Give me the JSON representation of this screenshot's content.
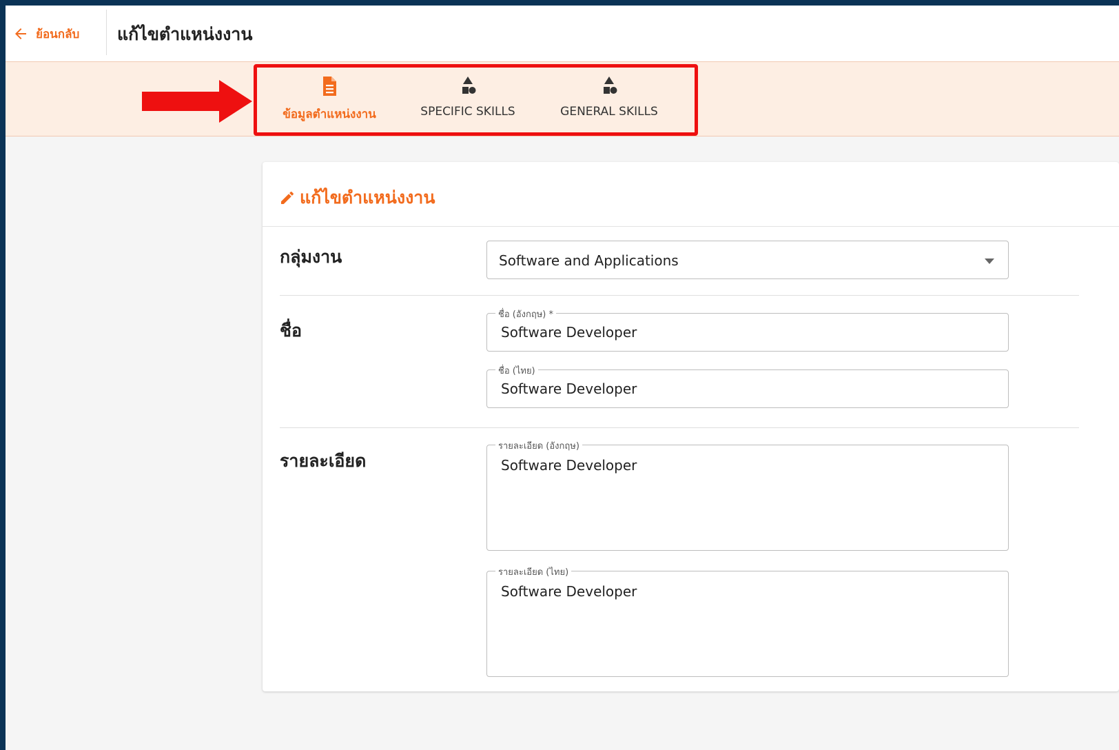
{
  "header": {
    "back_label": "ย้อนกลับ",
    "title": "แก้ไขตำแหน่งงาน"
  },
  "tabs": [
    {
      "label": "ข้อมูลตำแหน่งงาน",
      "icon": "file-document-icon",
      "active": true
    },
    {
      "label": "SPECIFIC SKILLS",
      "icon": "shapes-icon",
      "active": false
    },
    {
      "label": "GENERAL SKILLS",
      "icon": "shapes-icon",
      "active": false
    }
  ],
  "annotation": {
    "box_color": "#ee1010",
    "arrow_color": "#ee1010"
  },
  "card": {
    "title": "แก้ไขตำแหน่งงาน",
    "rows": {
      "job_group": {
        "label": "กลุ่มงาน",
        "value": "Software and Applications"
      },
      "name": {
        "label": "ชื่อ",
        "name_en_label": "ชื่อ (อังกฤษ) *",
        "name_en_value": "Software Developer",
        "name_th_label": "ชื่อ (ไทย)",
        "name_th_value": "Software Developer"
      },
      "detail": {
        "label": "รายละเอียด",
        "detail_en_label": "รายละเอียด (อังกฤษ)",
        "detail_en_value": "Software Developer",
        "detail_th_label": "รายละเอียด (ไทย)",
        "detail_th_value": "Software Developer"
      }
    }
  },
  "colors": {
    "accent": "#f26b1d",
    "tab_bar_bg": "#fdeee3",
    "frame_bg": "#0b3356"
  }
}
